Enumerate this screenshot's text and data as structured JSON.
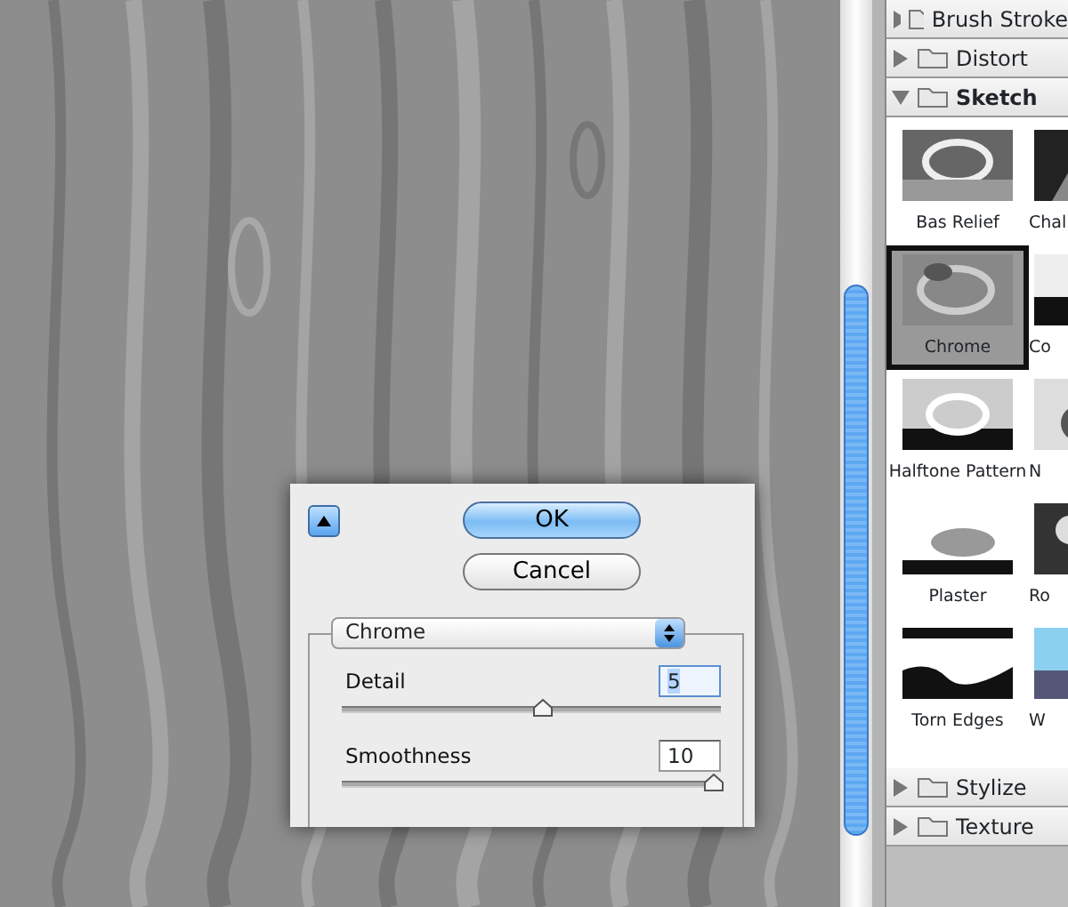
{
  "dialog": {
    "buttons": [
      {
        "label": "OK",
        "default": true
      },
      {
        "label": "Cancel",
        "default": false
      }
    ],
    "filter_select": {
      "value": "Chrome"
    },
    "sliders": [
      {
        "label": "Detail",
        "value": "5",
        "value_selected": true,
        "level": 0.53
      },
      {
        "label": "Smoothness",
        "value": "10",
        "value_selected": false,
        "level": 0.98
      }
    ]
  },
  "filter_panel": {
    "categories": [
      {
        "name": "Brush Stroke",
        "expanded": false
      },
      {
        "name": "Distort",
        "expanded": false
      },
      {
        "name": "Sketch",
        "expanded": true,
        "filters": [
          {
            "label": "Bas Relief",
            "selected": false
          },
          {
            "label": "Chal",
            "selected": false
          },
          {
            "label": "Chrome",
            "selected": true
          },
          {
            "label": "Co",
            "selected": false
          },
          {
            "label": "Halftone Pattern",
            "selected": false
          },
          {
            "label": "N",
            "selected": false
          },
          {
            "label": "Plaster",
            "selected": false
          },
          {
            "label": "Ro",
            "selected": false
          },
          {
            "label": "Torn Edges",
            "selected": false
          },
          {
            "label": "W",
            "selected": false
          }
        ]
      },
      {
        "name": "Stylize",
        "expanded": false
      },
      {
        "name": "Texture",
        "expanded": false
      }
    ]
  }
}
